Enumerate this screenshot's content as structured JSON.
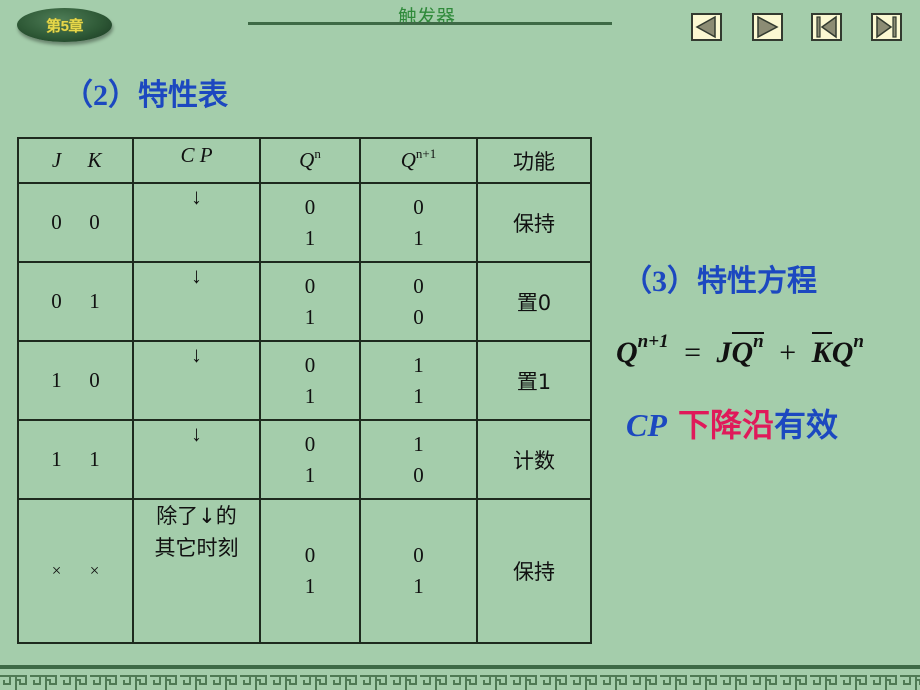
{
  "header": {
    "chapter_badge": "第5章",
    "title": "触发器",
    "nav_buttons": [
      {
        "name": "previous",
        "icon": "triangle-left-icon"
      },
      {
        "name": "next",
        "icon": "triangle-right-icon"
      },
      {
        "name": "first",
        "icon": "skip-first-icon"
      },
      {
        "name": "last",
        "icon": "skip-last-icon"
      }
    ]
  },
  "section2": {
    "number": "（2）",
    "title": "特性表"
  },
  "table": {
    "headers": {
      "jk_j": "J",
      "jk_k": "K",
      "cp": "C P",
      "qn_base": "Q",
      "qn_sup": "n",
      "qn1_base": "Q",
      "qn1_sup": "n+1",
      "function": "功能"
    },
    "rows": [
      {
        "j": "0",
        "k": "0",
        "cp": "↓",
        "qn": [
          "0",
          "1"
        ],
        "qn1": [
          "0",
          "1"
        ],
        "function": "保持"
      },
      {
        "j": "0",
        "k": "1",
        "cp": "↓",
        "qn": [
          "0",
          "1"
        ],
        "qn1": [
          "0",
          "0"
        ],
        "function": "置0"
      },
      {
        "j": "1",
        "k": "0",
        "cp": "↓",
        "qn": [
          "0",
          "1"
        ],
        "qn1": [
          "1",
          "1"
        ],
        "function": "置1"
      },
      {
        "j": "1",
        "k": "1",
        "cp": "↓",
        "qn": [
          "0",
          "1"
        ],
        "qn1": [
          "1",
          "0"
        ],
        "function": "计数"
      },
      {
        "j": "×",
        "k": "×",
        "cp_line1": "除了↓的",
        "cp_line2": "其它时刻",
        "qn": [
          "0",
          "1"
        ],
        "qn1": [
          "0",
          "1"
        ],
        "function": "保持"
      }
    ]
  },
  "section3": {
    "number": "（3）",
    "title": "特性方程"
  },
  "equation": {
    "lhs": "Q",
    "lhs_sup": "n+1",
    "eq": "=",
    "term1_j": "J",
    "term1_q": "Q",
    "term1_sup": "n",
    "plus": "+",
    "term2_k": "K",
    "term2_q": "Q",
    "term2_sup": "n"
  },
  "note": {
    "cp": "CP",
    "edge": "下降沿",
    "valid": "有效"
  },
  "colors": {
    "background": "#a4cdab",
    "heading": "#1c48c0",
    "highlight": "#e0195a",
    "title_green": "#2f8a3a"
  }
}
